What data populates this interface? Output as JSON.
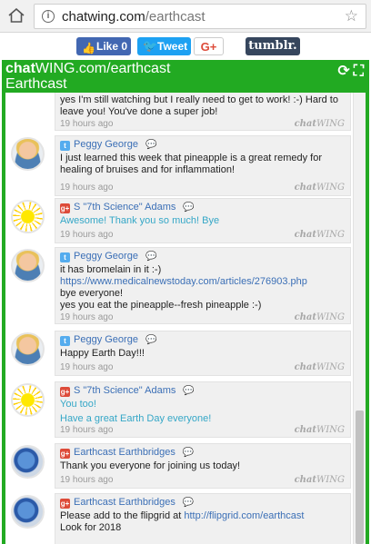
{
  "browser": {
    "url_host": "chatwing.com",
    "url_path": "/earthcast",
    "home_icon": "home-icon",
    "info_icon": "info-icon",
    "star_icon": "star-icon"
  },
  "share": {
    "facebook_label": "Like 0",
    "twitter_label": "Tweet",
    "gplus_label": "G+",
    "tumblr_label": "tumblr."
  },
  "widget": {
    "brand_bold": "chat",
    "brand_rest": "WING.com/earthcast",
    "room": "Earthcast",
    "colors": {
      "accent": "#22aa22",
      "link": "#3b6fb6",
      "teal": "#35a7c7"
    }
  },
  "watermark": {
    "bold": "chat",
    "rest": "WING"
  },
  "messages": [
    {
      "user": "",
      "lines": [
        "yes I'm still watching but I really need to get to work! :-) Hard to",
        "leave you! You've done a super job!"
      ],
      "time": "19 hours ago"
    },
    {
      "user": "Peggy George",
      "lines": [
        "I just learned this week that pineapple is a great remedy for",
        "healing of bruises and for inflammation!"
      ],
      "time": "19 hours ago"
    },
    {
      "user": "S \"7th Science\" Adams",
      "lines": [
        "Awesome! Thank you so much! Bye"
      ],
      "time": "19 hours ago"
    },
    {
      "user": "Peggy George",
      "lines": [
        "it has bromelain in it :-)",
        "https://www.medicalnewstoday.com/articles/276903.php",
        "bye everyone!",
        "yes you eat the pineapple--fresh pineapple :-)"
      ],
      "time": "19 hours ago"
    },
    {
      "user": "Peggy George",
      "lines": [
        "Happy Earth Day!!!"
      ],
      "time": "19 hours ago"
    },
    {
      "user": "S \"7th Science\" Adams",
      "lines": [
        "You too!",
        "Have a great Earth Day everyone!"
      ],
      "time": "19 hours ago"
    },
    {
      "user": "Earthcast Earthbridges",
      "lines": [
        "Thank you everyone for joining us today!"
      ],
      "time": "19 hours ago"
    },
    {
      "user": "Earthcast Earthbridges",
      "lines": [
        "Please add to the flipgrid at ",
        "http://flipgrid.com/earthcast",
        "Look for 2018"
      ],
      "time": ""
    }
  ]
}
